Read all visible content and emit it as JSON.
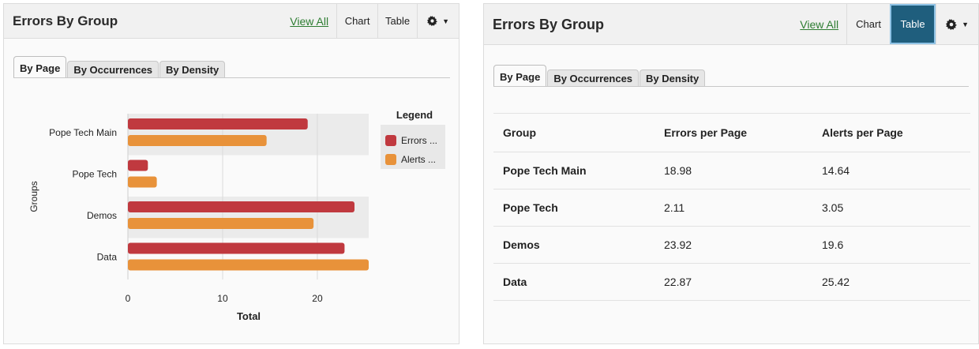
{
  "left_panel": {
    "title": "Errors By Group",
    "view_all": "View All",
    "chart_button": "Chart",
    "table_button": "Table",
    "tabs": [
      "By Page",
      "By Occurrences",
      "By Density"
    ],
    "active_tab": 0
  },
  "right_panel": {
    "title": "Errors By Group",
    "view_all": "View All",
    "chart_button": "Chart",
    "table_button": "Table",
    "tabs": [
      "By Page",
      "By Occurrences",
      "By Density"
    ],
    "active_tab": 0,
    "table": {
      "headers": [
        "Group",
        "Errors per Page",
        "Alerts per Page"
      ],
      "rows": [
        [
          "Pope Tech Main",
          "18.98",
          "14.64"
        ],
        [
          "Pope Tech",
          "2.11",
          "3.05"
        ],
        [
          "Demos",
          "23.92",
          "19.6"
        ],
        [
          "Data",
          "22.87",
          "25.42"
        ]
      ]
    }
  },
  "colors": {
    "errors": "#c0393f",
    "alerts": "#e8923a",
    "active_button": "#1f5e7d",
    "link": "#2e7d32"
  },
  "chart_data": {
    "type": "bar",
    "orientation": "horizontal",
    "categories": [
      "Pope Tech Main",
      "Pope Tech",
      "Demos",
      "Data"
    ],
    "series": [
      {
        "name": "Errors ...",
        "values": [
          18.98,
          2.11,
          23.92,
          22.87
        ]
      },
      {
        "name": "Alerts ...",
        "values": [
          14.64,
          3.05,
          19.6,
          25.42
        ]
      }
    ],
    "xlabel": "Total",
    "ylabel": "Groups",
    "xlim": [
      0,
      25.42
    ],
    "xticks": [
      0,
      10,
      20
    ],
    "legend_title": "Legend",
    "legend_position": "right",
    "grid": true
  }
}
